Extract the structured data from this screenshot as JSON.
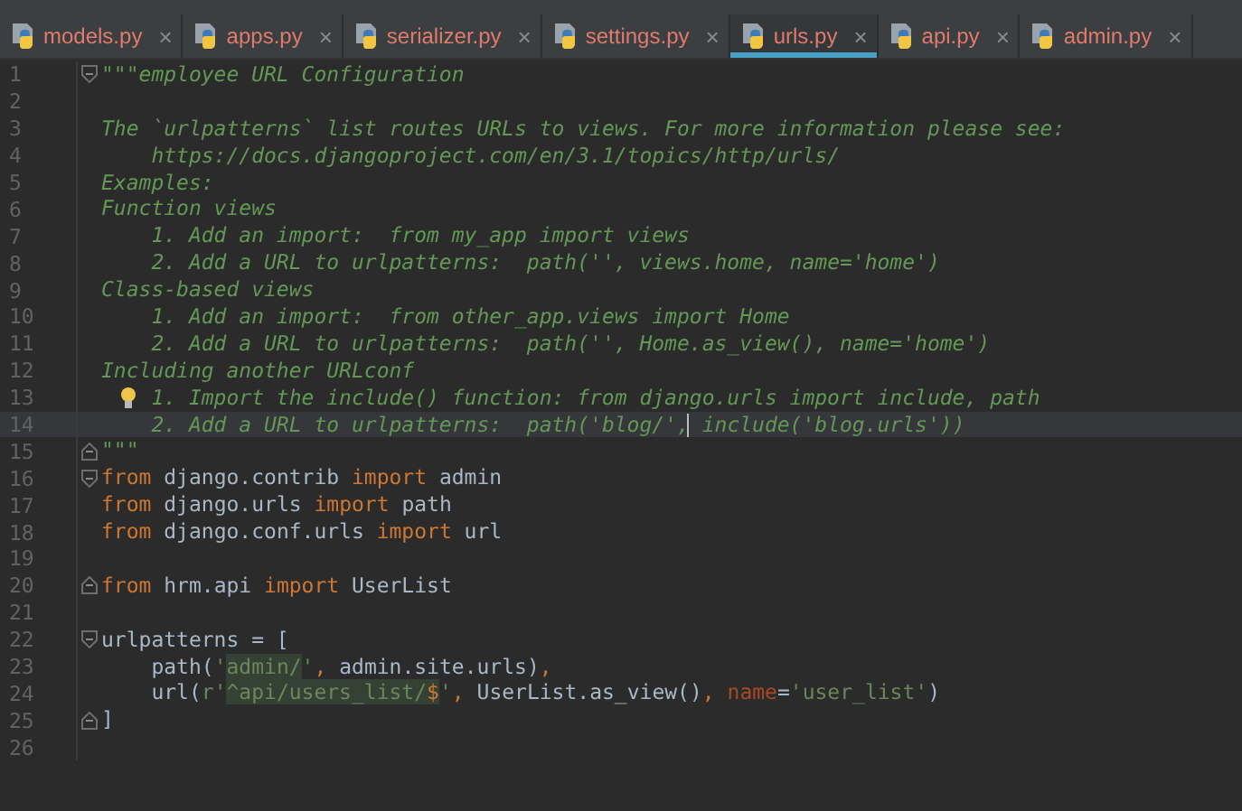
{
  "tabs": [
    {
      "label": "models.py",
      "selected": false,
      "close": "×"
    },
    {
      "label": "apps.py",
      "selected": false,
      "close": "×"
    },
    {
      "label": "serializer.py",
      "selected": false,
      "close": "×"
    },
    {
      "label": "settings.py",
      "selected": false,
      "close": "×"
    },
    {
      "label": "urls.py",
      "selected": true,
      "close": "×"
    },
    {
      "label": "api.py",
      "selected": false,
      "close": "×"
    },
    {
      "label": "admin.py",
      "selected": false,
      "close": "×"
    }
  ],
  "editor": {
    "lines": [
      {
        "number": "1",
        "fold_start": true,
        "tokens": [
          {
            "kind": "doc",
            "text": "\"\"\"employee URL Configuration"
          }
        ]
      },
      {
        "number": "2"
      },
      {
        "number": "3",
        "tokens": [
          {
            "kind": "doc",
            "text": "The `urlpatterns` list routes URLs to views. For more information please see:"
          }
        ]
      },
      {
        "number": "4",
        "tokens": [
          {
            "kind": "doc",
            "text": "    https://docs.djangoproject.com/en/3.1/topics/http/urls/"
          }
        ]
      },
      {
        "number": "5",
        "tokens": [
          {
            "kind": "doc",
            "text": "Examples:"
          }
        ]
      },
      {
        "number": "6",
        "tokens": [
          {
            "kind": "doc",
            "text": "Function views"
          }
        ]
      },
      {
        "number": "7",
        "tokens": [
          {
            "kind": "doc",
            "text": "    1. Add an import:  from my_app import views"
          }
        ]
      },
      {
        "number": "8",
        "tokens": [
          {
            "kind": "doc",
            "text": "    2. Add a URL to urlpatterns:  path('', views.home, name='home')"
          }
        ]
      },
      {
        "number": "9",
        "tokens": [
          {
            "kind": "doc",
            "text": "Class-based views"
          }
        ]
      },
      {
        "number": "10",
        "tokens": [
          {
            "kind": "doc",
            "text": "    1. Add an import:  from other_app.views import Home"
          }
        ]
      },
      {
        "number": "11",
        "tokens": [
          {
            "kind": "doc",
            "text": "    2. Add a URL to urlpatterns:  path('', Home.as_view(), name='home')"
          }
        ]
      },
      {
        "number": "12",
        "tokens": [
          {
            "kind": "doc",
            "text": "Including another URLconf"
          }
        ]
      },
      {
        "number": "13",
        "hint": true,
        "tokens": [
          {
            "kind": "doc",
            "text": "1. Import the include() function: from django.urls import include, path"
          }
        ]
      },
      {
        "number": "14",
        "current": true,
        "tokens": [
          {
            "kind": "doc",
            "text": "    2. Add a URL to urlpatterns:  path('blog/',"
          },
          {
            "kind": "caret"
          },
          {
            "kind": "doc",
            "text": " include('blog.urls'))"
          }
        ]
      },
      {
        "number": "15",
        "fold_end": true,
        "tokens": [
          {
            "kind": "doc",
            "text": "\"\"\""
          }
        ]
      },
      {
        "number": "16",
        "fold_start": true,
        "tokens": [
          {
            "kind": "keyword",
            "text": "from"
          },
          {
            "kind": "plain",
            "text": " django.contrib "
          },
          {
            "kind": "keyword",
            "text": "import"
          },
          {
            "kind": "plain",
            "text": " admin"
          }
        ]
      },
      {
        "number": "17",
        "tokens": [
          {
            "kind": "keyword",
            "text": "from"
          },
          {
            "kind": "plain",
            "text": " django.urls "
          },
          {
            "kind": "keyword",
            "text": "import"
          },
          {
            "kind": "plain",
            "text": " path"
          }
        ]
      },
      {
        "number": "18",
        "tokens": [
          {
            "kind": "keyword",
            "text": "from"
          },
          {
            "kind": "plain",
            "text": " django.conf.urls "
          },
          {
            "kind": "keyword",
            "text": "import"
          },
          {
            "kind": "plain",
            "text": " url"
          }
        ]
      },
      {
        "number": "19"
      },
      {
        "number": "20",
        "fold_end": true,
        "tokens": [
          {
            "kind": "keyword",
            "text": "from"
          },
          {
            "kind": "plain",
            "text": " hrm.api "
          },
          {
            "kind": "keyword",
            "text": "import"
          },
          {
            "kind": "plain",
            "text": " UserList"
          }
        ]
      },
      {
        "number": "21"
      },
      {
        "number": "22",
        "fold_start": true,
        "tokens": [
          {
            "kind": "plain",
            "text": "urlpatterns = ["
          }
        ]
      },
      {
        "number": "23",
        "tokens": [
          {
            "kind": "plain",
            "text": "    path("
          },
          {
            "kind": "string",
            "text": "'"
          },
          {
            "kind": "injected",
            "text": "admin/"
          },
          {
            "kind": "string",
            "text": "'"
          },
          {
            "kind": "keyword",
            "text": ","
          },
          {
            "kind": "plain",
            "text": " admin.site.urls)"
          },
          {
            "kind": "keyword",
            "text": ","
          }
        ]
      },
      {
        "number": "24",
        "tokens": [
          {
            "kind": "plain",
            "text": "    url("
          },
          {
            "kind": "string",
            "text": "r'"
          },
          {
            "kind": "injected",
            "text": "^api/users_list/"
          },
          {
            "kind": "injected-op",
            "text": "$"
          },
          {
            "kind": "string",
            "text": "'"
          },
          {
            "kind": "keyword",
            "text": ","
          },
          {
            "kind": "plain",
            "text": " UserList.as_view()"
          },
          {
            "kind": "keyword",
            "text": ", "
          },
          {
            "kind": "param",
            "text": "name"
          },
          {
            "kind": "plain",
            "text": "="
          },
          {
            "kind": "string",
            "text": "'user_list'"
          },
          {
            "kind": "plain",
            "text": ")"
          }
        ]
      },
      {
        "number": "25",
        "fold_end": true,
        "tokens": [
          {
            "kind": "plain",
            "text": "]"
          }
        ]
      },
      {
        "number": "26"
      }
    ]
  }
}
